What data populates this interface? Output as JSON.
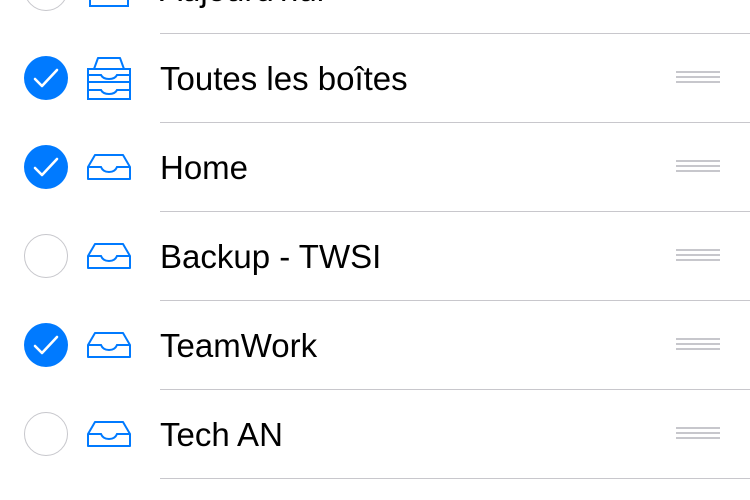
{
  "accent_color": "#007aff",
  "mailboxes": [
    {
      "label": "Aujourd'hui",
      "checked": false,
      "icon": "calendar-icon"
    },
    {
      "label": "Toutes les boîtes",
      "checked": true,
      "icon": "all-inboxes-icon"
    },
    {
      "label": "Home",
      "checked": true,
      "icon": "inbox-icon"
    },
    {
      "label": "Backup - TWSI",
      "checked": false,
      "icon": "inbox-icon"
    },
    {
      "label": "TeamWork",
      "checked": true,
      "icon": "inbox-icon"
    },
    {
      "label": "Tech AN",
      "checked": false,
      "icon": "inbox-icon"
    }
  ]
}
